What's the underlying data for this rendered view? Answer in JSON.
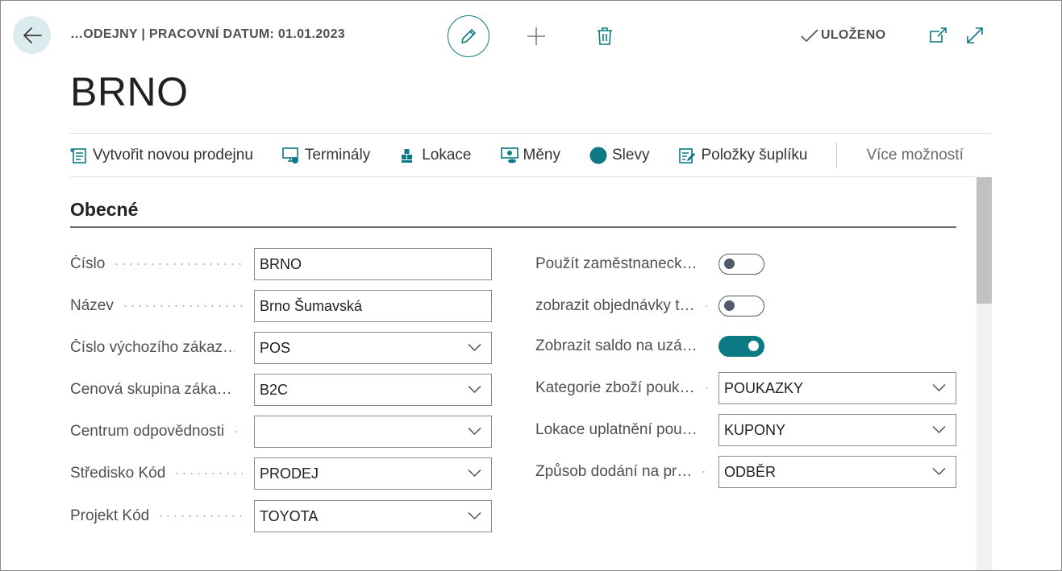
{
  "header": {
    "breadcrumb": "…ODEJNY | PRACOVNÍ DATUM: 01.01.2023",
    "saved_label": "ULOŽENO"
  },
  "page": {
    "title": "BRNO"
  },
  "actions": [
    {
      "label": "Vytvořit novou prodejnu",
      "icon": "new-document-icon"
    },
    {
      "label": "Terminály",
      "icon": "terminal-icon"
    },
    {
      "label": "Lokace",
      "icon": "location-icon"
    },
    {
      "label": "Měny",
      "icon": "currency-icon"
    },
    {
      "label": "Slevy",
      "icon": "discount-icon"
    },
    {
      "label": "Položky šuplíku",
      "icon": "drawer-items-icon"
    }
  ],
  "more_label": "Více možností",
  "section": {
    "title": "Obecné"
  },
  "left_fields": [
    {
      "label": "Číslo",
      "value": "BRNO",
      "type": "text"
    },
    {
      "label": "Název",
      "value": "Brno Šumavská",
      "type": "text"
    },
    {
      "label": "Číslo výchozího zákaz…",
      "value": "POS",
      "type": "select"
    },
    {
      "label": "Cenová skupina záka…",
      "value": "B2C",
      "type": "select"
    },
    {
      "label": "Centrum odpovědnosti",
      "value": "",
      "type": "select"
    },
    {
      "label": "Středisko Kód",
      "value": "PRODEJ",
      "type": "select"
    },
    {
      "label": "Projekt Kód",
      "value": "TOYOTA",
      "type": "select"
    }
  ],
  "right_fields": [
    {
      "label": "Použít zaměstnaneck…",
      "type": "toggle",
      "value": false
    },
    {
      "label": "zobrazit objednávky t…",
      "type": "toggle",
      "value": false
    },
    {
      "label": "Zobrazit saldo na uzá…",
      "type": "toggle",
      "value": true
    },
    {
      "label": "Kategorie zboží pouk…",
      "type": "select",
      "value": "POUKAZKY"
    },
    {
      "label": "Lokace uplatnění pou…",
      "type": "select",
      "value": "KUPONY"
    },
    {
      "label": "Způsob dodání na pr…",
      "type": "select",
      "value": "ODBĚR"
    }
  ],
  "colors": {
    "accent": "#0b7a83",
    "back_button_bg": "#dcebee"
  }
}
